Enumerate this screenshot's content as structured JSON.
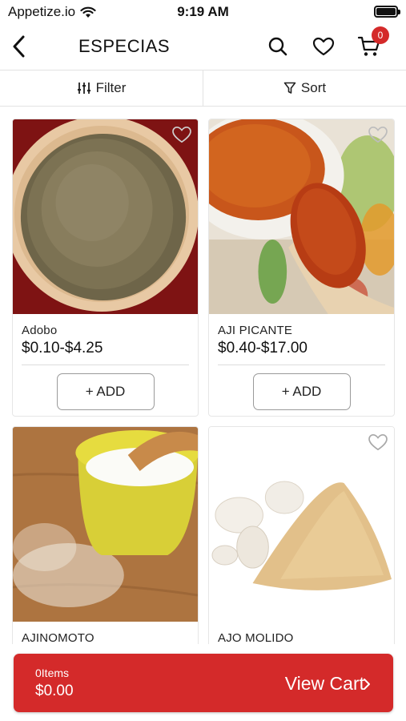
{
  "status_bar": {
    "carrier": "Appetize.io",
    "time": "9:19 AM",
    "wifi_icon": "wifi-icon",
    "battery_icon": "battery-icon"
  },
  "nav": {
    "title": "ESPECIAS",
    "back_icon": "chevron-left-icon",
    "search_icon": "search-icon",
    "wishlist_icon": "heart-icon",
    "cart_icon": "cart-icon",
    "cart_badge": "0"
  },
  "toolbar": {
    "filter_label": "Filter",
    "sort_label": "Sort"
  },
  "products": [
    {
      "name": "Adobo",
      "price": "$0.10-$4.25",
      "add_label": "+ ADD"
    },
    {
      "name": "AJI PICANTE",
      "price": "$0.40-$17.00",
      "add_label": "+ ADD"
    },
    {
      "name": "AJINOMOTO",
      "price": "",
      "add_label": ""
    },
    {
      "name": "AJO MOLIDO",
      "price": "",
      "add_label": ""
    }
  ],
  "cart_bar": {
    "items": "0Items",
    "total": "$0.00",
    "view_cart_label": "View Cart"
  },
  "colors": {
    "accent": "#d42a2a",
    "border": "#e2e2e2"
  }
}
